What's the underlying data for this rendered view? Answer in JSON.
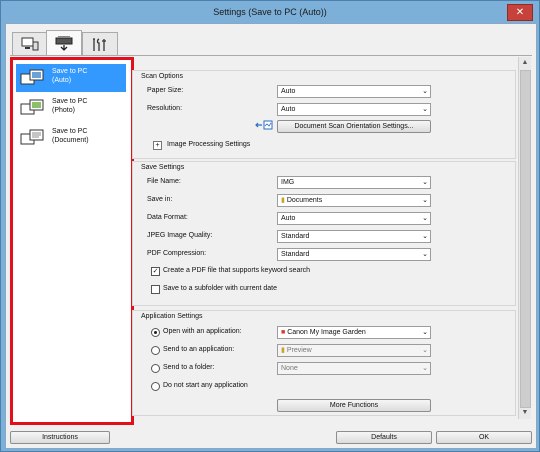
{
  "window": {
    "title": "Settings (Save to PC (Auto))"
  },
  "tabs": [
    {
      "icon": "scan-from-computer-icon"
    },
    {
      "icon": "scan-from-panel-icon"
    },
    {
      "icon": "general-settings-tools-icon"
    }
  ],
  "left_panel": {
    "items": [
      {
        "label_line1": "Save to PC",
        "label_line2": "(Auto)",
        "selected": true
      },
      {
        "label_line1": "Save to PC",
        "label_line2": "(Photo)",
        "selected": false
      },
      {
        "label_line1": "Save to PC",
        "label_line2": "(Document)",
        "selected": false
      }
    ]
  },
  "scan_options": {
    "title": "Scan Options",
    "paper_size_label": "Paper Size:",
    "paper_size_value": "Auto",
    "resolution_label": "Resolution:",
    "resolution_value": "Auto",
    "orientation_button": "Document Scan Orientation Settings...",
    "image_processing_label": "Image Processing Settings"
  },
  "save_settings": {
    "title": "Save Settings",
    "file_name_label": "File Name:",
    "file_name_value": "IMG",
    "save_in_label": "Save in:",
    "save_in_value": "Documents",
    "data_format_label": "Data Format:",
    "data_format_value": "Auto",
    "jpeg_quality_label": "JPEG Image Quality:",
    "jpeg_quality_value": "Standard",
    "pdf_compression_label": "PDF Compression:",
    "pdf_compression_value": "Standard",
    "pdf_keyword_label": "Create a PDF file that supports keyword search",
    "pdf_keyword_checked": true,
    "subfolder_label": "Save to a subfolder with current date",
    "subfolder_checked": false
  },
  "application_settings": {
    "title": "Application Settings",
    "open_app_label": "Open with an application:",
    "open_app_value": "Canon My Image Garden",
    "send_app_label": "Send to an application:",
    "send_app_value": "Preview",
    "send_folder_label": "Send to a folder:",
    "send_folder_value": "None",
    "no_app_label": "Do not start any application",
    "more_functions_button": "More Functions",
    "selected_option": "open_app"
  },
  "footer": {
    "instructions_button": "Instructions",
    "defaults_button": "Defaults",
    "ok_button": "OK"
  },
  "colors": {
    "selection_blue": "#3399ff",
    "highlight_red": "#e3101c"
  }
}
